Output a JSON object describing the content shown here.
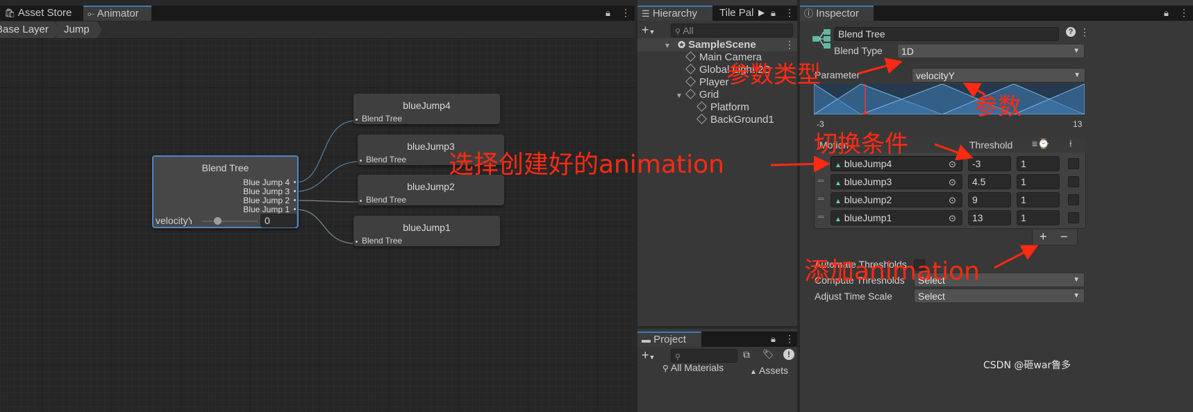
{
  "tabs": {
    "asset_store": "Asset Store",
    "animator": "Animator",
    "hierarchy": "Hierarchy",
    "tile_palette": "Tile Pal",
    "inspector": "Inspector",
    "project": "Project"
  },
  "animator": {
    "breadcrumb": [
      "Base Layer",
      "Jump"
    ],
    "blend_tree_node": {
      "title": "Blend Tree",
      "outputs": [
        "Blue Jump 4",
        "Blue Jump 3",
        "Blue Jump 2",
        "Blue Jump 1"
      ],
      "param_label": "velocityY",
      "param_value": "0",
      "slider_position": 0.28
    },
    "child_nodes": [
      {
        "title": "blueJump4",
        "subtitle": "Blend Tree"
      },
      {
        "title": "blueJump3",
        "subtitle": "Blend Tree"
      },
      {
        "title": "blueJump2",
        "subtitle": "Blend Tree"
      },
      {
        "title": "blueJump1",
        "subtitle": "Blend Tree"
      }
    ]
  },
  "hierarchy": {
    "search_placeholder": "All",
    "scene": "SampleScene",
    "items": [
      "Main Camera",
      "Global Light 2D",
      "Player",
      "Grid",
      "Platform",
      "BackGround1"
    ]
  },
  "inspector": {
    "name": "Blend Tree",
    "blend_type_label": "Blend Type",
    "blend_type_value": "1D",
    "parameter_label": "Parameter",
    "parameter_value": "velocityY",
    "range_min": "-3",
    "range_max": "13",
    "motion_header": "Motion",
    "threshold_header": "Threshold",
    "motions": [
      {
        "name": "blueJump4",
        "threshold": "-3",
        "speed": "1"
      },
      {
        "name": "blueJump3",
        "threshold": "4.5",
        "speed": "1"
      },
      {
        "name": "blueJump2",
        "threshold": "9",
        "speed": "1"
      },
      {
        "name": "blueJump1",
        "threshold": "13",
        "speed": "1"
      }
    ],
    "add_label": "+",
    "remove_label": "−",
    "automate_label": "Automate Thresholds",
    "compute_label": "Compute Thresholds",
    "compute_value": "Select",
    "adjust_label": "Adjust Time Scale",
    "adjust_value": "Select"
  },
  "project": {
    "all_materials": "All Materials",
    "assets": "Assets"
  },
  "annotations": {
    "param_type": "参数类型",
    "param": "参数",
    "switch_condition": "切换条件",
    "choose_animation": "选择创建好的animation",
    "add_animation": "添加animation"
  },
  "watermark": "CSDN @砸war鲁多",
  "colors": {
    "accent": "#3a79bb",
    "annotation": "#ff2a12",
    "graph_blue": "#3f7cb3"
  }
}
